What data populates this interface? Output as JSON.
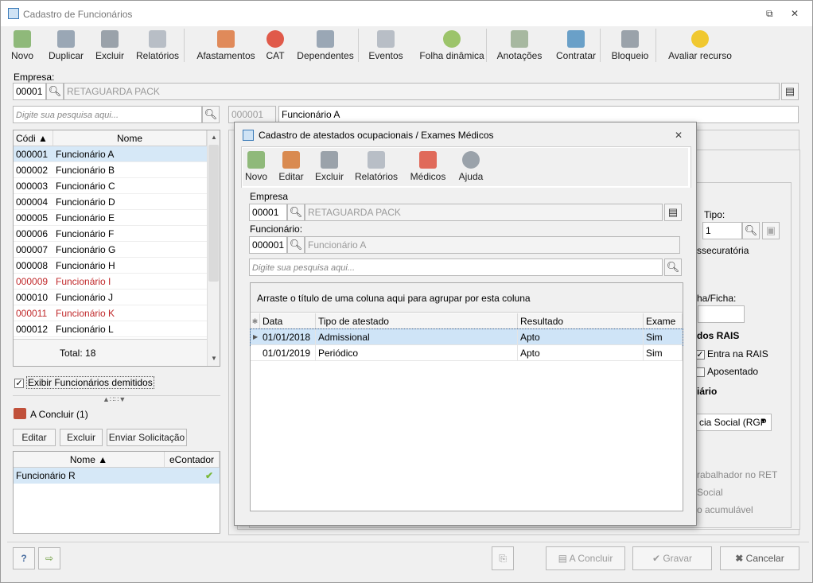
{
  "window": {
    "title": "Cadastro de Funcionários",
    "restore_glyph": "⧉",
    "close_glyph": "✕"
  },
  "toolbar": [
    {
      "id": "novo",
      "label": "Novo",
      "icon": "new-doc-icon",
      "color": "#8fb97a"
    },
    {
      "id": "duplicar",
      "label": "Duplicar",
      "icon": "users-icon",
      "color": "#9aa7b5"
    },
    {
      "id": "excluir",
      "label": "Excluir",
      "icon": "trash-icon",
      "color": "#9aa2aa"
    },
    {
      "id": "relatorios",
      "label": "Relatórios",
      "icon": "report-icon",
      "color": "#b8bec6"
    },
    {
      "id": "afastamentos",
      "label": "Afastamentos",
      "icon": "house-icon",
      "color": "#e08a5a"
    },
    {
      "id": "cat",
      "label": "CAT",
      "icon": "medical-cross-icon",
      "color": "#e05a4a"
    },
    {
      "id": "dependentes",
      "label": "Dependentes",
      "icon": "users-icon",
      "color": "#9aa7b5"
    },
    {
      "id": "eventos",
      "label": "Eventos",
      "icon": "list-icon",
      "color": "#b8bec6"
    },
    {
      "id": "folha",
      "label": "Folha dinâmica",
      "icon": "calendar-icon",
      "color": "#9cc46a"
    },
    {
      "id": "anotacoes",
      "label": "Anotações",
      "icon": "notes-icon",
      "color": "#a7b8a0"
    },
    {
      "id": "contratar",
      "label": "Contratar",
      "icon": "hire-icon",
      "color": "#6aa0c8"
    },
    {
      "id": "bloqueio",
      "label": "Bloqueio",
      "icon": "lock-icon",
      "color": "#9aa2aa"
    },
    {
      "id": "avaliar",
      "label": "Avaliar recurso",
      "icon": "star-icon",
      "color": "#f0c830"
    }
  ],
  "empresa": {
    "label": "Empresa:",
    "code": "00001",
    "name": "RETAGUARDA PACK"
  },
  "search": {
    "placeholder": "Digite sua pesquisa aqui..."
  },
  "current": {
    "code": "000001",
    "name": "Funcionário A"
  },
  "list": {
    "headers": {
      "code": "Códi ▲",
      "name": "Nome"
    },
    "rows": [
      {
        "code": "000001",
        "name": "Funcionário A",
        "red": false
      },
      {
        "code": "000002",
        "name": "Funcionário B",
        "red": false
      },
      {
        "code": "000003",
        "name": "Funcionário C",
        "red": false
      },
      {
        "code": "000004",
        "name": "Funcionário D",
        "red": false
      },
      {
        "code": "000005",
        "name": "Funcionário E",
        "red": false
      },
      {
        "code": "000006",
        "name": "Funcionário F",
        "red": false
      },
      {
        "code": "000007",
        "name": "Funcionário G",
        "red": false
      },
      {
        "code": "000008",
        "name": "Funcionário H",
        "red": false
      },
      {
        "code": "000009",
        "name": "Funcionário I",
        "red": true
      },
      {
        "code": "000010",
        "name": "Funcionário J",
        "red": false
      },
      {
        "code": "000011",
        "name": "Funcionário K",
        "red": true
      },
      {
        "code": "000012",
        "name": "Funcionário L",
        "red": false
      }
    ],
    "total": "Total: 18"
  },
  "show_dismissed": "Exibir Funcionários demitidos",
  "pending": {
    "title": "A Concluir (1)",
    "buttons": {
      "editar": "Editar",
      "excluir": "Excluir",
      "enviar": "Enviar Solicitação"
    },
    "headers": {
      "nome": "Nome ▲",
      "econtador": "eContador"
    },
    "rows": [
      {
        "nome": "Funcionário R",
        "econtador": "✔"
      }
    ]
  },
  "right_partial": {
    "tipo_label": "Tipo:",
    "tipo_value": "1",
    "assec": "ssecuratória",
    "ficha": "ha/Ficha:",
    "rais_title": "dos RAIS",
    "entra_rais": "Entra na RAIS",
    "aposentado": "Aposentado",
    "ciario": "iário",
    "previdencia": "cia Social (RGP",
    "trab_ret": "rabalhador no RET",
    "social": "Social",
    "acumulavel": "o acumulável"
  },
  "footer": {
    "help": "?",
    "concluir": "A Concluir",
    "gravar": "Gravar",
    "cancelar": "Cancelar"
  },
  "dialog": {
    "title": "Cadastro de atestados ocupacionais / Exames Médicos",
    "toolbar": [
      {
        "label": "Novo",
        "icon": "new-doc-icon",
        "color": "#8fb97a"
      },
      {
        "label": "Editar",
        "icon": "edit-icon",
        "color": "#d98a50"
      },
      {
        "label": "Excluir",
        "icon": "trash-icon",
        "color": "#9aa2aa"
      },
      {
        "label": "Relatórios",
        "icon": "report-icon",
        "color": "#b8bec6"
      },
      {
        "label": "Médicos",
        "icon": "doctors-icon",
        "color": "#e06a5a"
      },
      {
        "label": "Ajuda",
        "icon": "help-icon",
        "color": "#9aa2aa"
      }
    ],
    "empresa_label": "Empresa",
    "empresa_code": "00001",
    "empresa_name": "RETAGUARDA PACK",
    "func_label": "Funcionário:",
    "func_code": "000001",
    "func_name": "Funcionário A",
    "search_placeholder": "Digite sua pesquisa aqui...",
    "group_hint": "Arraste o título de uma coluna aqui para agrupar por esta coluna",
    "headers": {
      "data": "Data",
      "tipo": "Tipo de atestado",
      "resultado": "Resultado",
      "exame": "Exame"
    },
    "rows": [
      {
        "data": "01/01/2018",
        "tipo": "Admissional",
        "resultado": "Apto",
        "exame": "Sim"
      },
      {
        "data": "01/01/2019",
        "tipo": "Periódico",
        "resultado": "Apto",
        "exame": "Sim"
      }
    ]
  }
}
